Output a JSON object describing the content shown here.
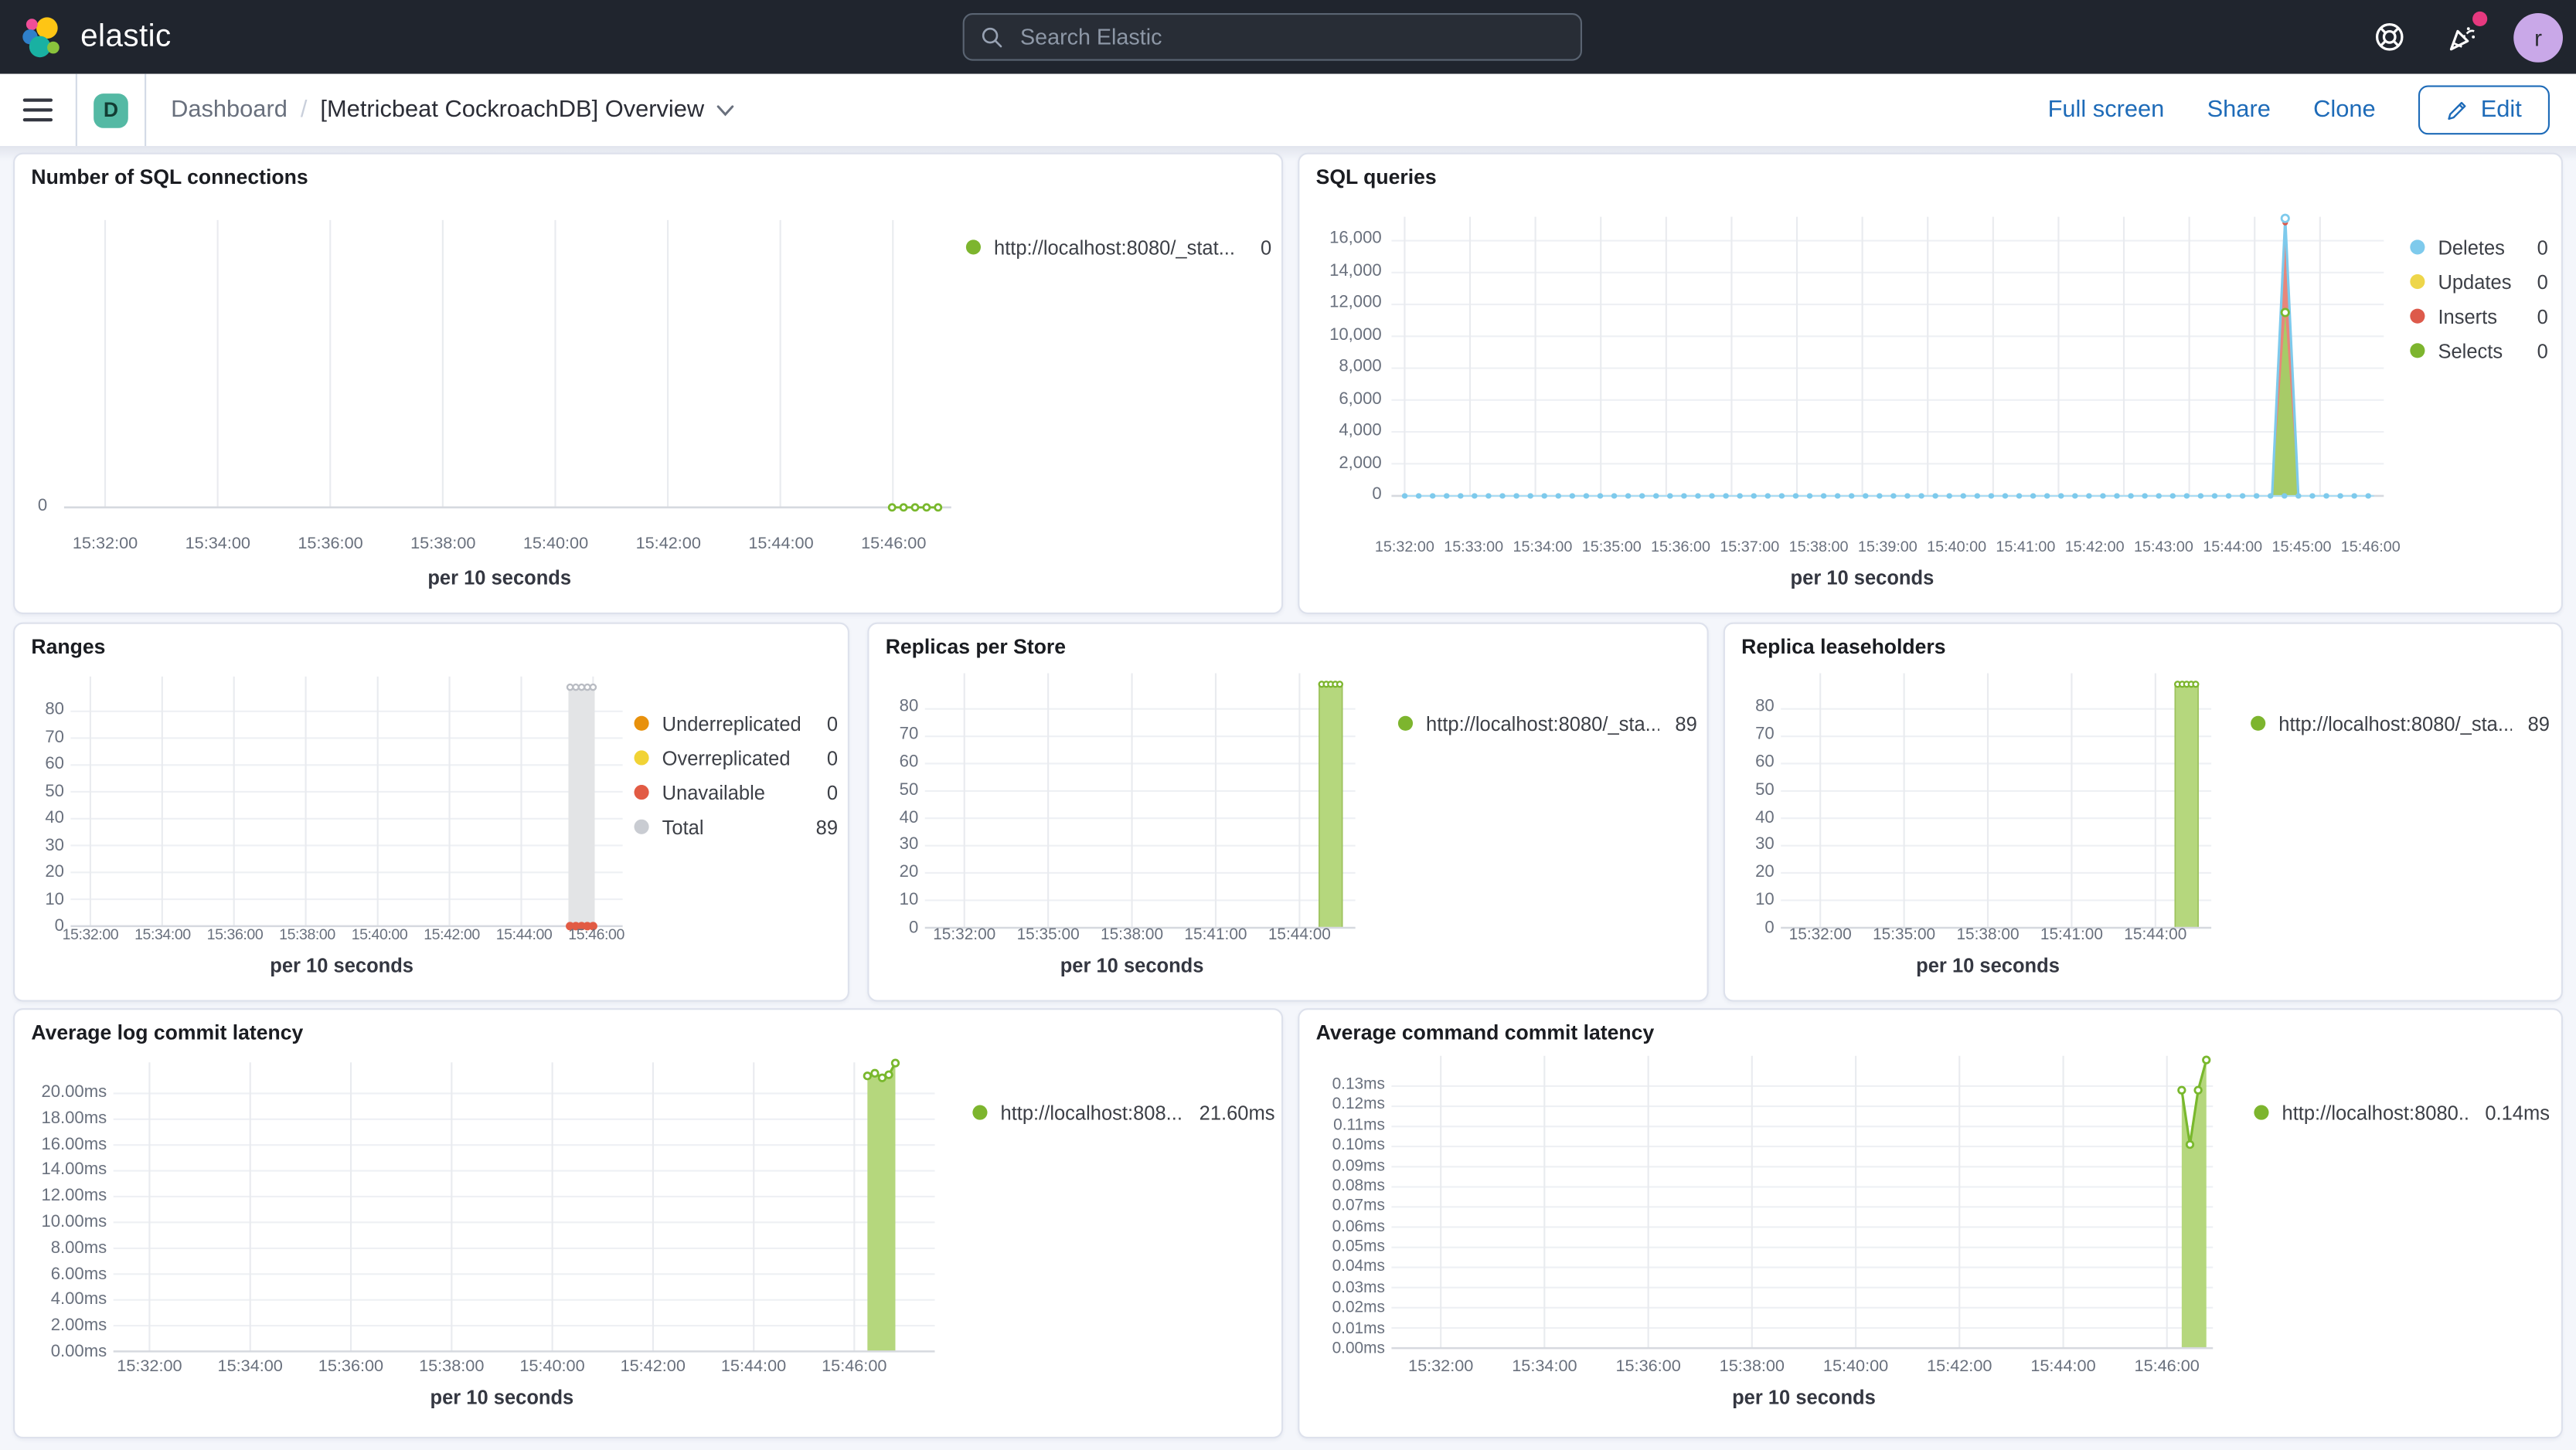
{
  "colors": {
    "header_bg": "#20252e",
    "link_blue": "#1e6bb8",
    "badge_teal": "#54b9a4",
    "avatar_purple": "#c9a8e8",
    "notification_pink": "#e6397f",
    "series_green": "#7db52e",
    "series_green_fill": "#b5d77d",
    "series_blue": "#7ecaec",
    "series_yellow": "#eed64a",
    "series_red": "#dd5a4b",
    "series_orange": "#e8910c",
    "series_gray": "#c9ccd2"
  },
  "header": {
    "logo_text": "elastic",
    "search_placeholder": "Search Elastic",
    "avatar_initial": "r"
  },
  "toolbar": {
    "breadcrumb_root": "Dashboard",
    "breadcrumb_sep": "/",
    "title": "[Metricbeat CockroachDB] Overview",
    "full_screen": "Full screen",
    "share": "Share",
    "clone": "Clone",
    "edit": "Edit"
  },
  "chart_data": [
    {
      "type": "line",
      "title": "Number of SQL connections",
      "xlabel": "per 10 seconds",
      "x_ticks": [
        "15:32:00",
        "15:34:00",
        "15:36:00",
        "15:38:00",
        "15:40:00",
        "15:42:00",
        "15:44:00",
        "15:46:00"
      ],
      "y_ticks": [
        "0"
      ],
      "ylim": [
        0,
        1
      ],
      "legend": [
        {
          "label": "http://localhost:8080/_stat...",
          "value": "0",
          "color": "#7db52e"
        }
      ],
      "series": [
        {
          "name": "http://localhost:8080/_stat...",
          "x": [
            "15:45:20",
            "15:45:30",
            "15:45:40",
            "15:45:50",
            "15:46:00"
          ],
          "values": [
            0,
            0,
            0,
            0,
            0
          ]
        }
      ]
    },
    {
      "type": "line",
      "title": "SQL queries",
      "xlabel": "per 10 seconds",
      "x_ticks": [
        "15:32:00",
        "15:33:00",
        "15:34:00",
        "15:35:00",
        "15:36:00",
        "15:37:00",
        "15:38:00",
        "15:39:00",
        "15:40:00",
        "15:41:00",
        "15:42:00",
        "15:43:00",
        "15:44:00",
        "15:45:00",
        "15:46:00"
      ],
      "y_ticks": [
        "16,000",
        "14,000",
        "12,000",
        "10,000",
        "8,000",
        "6,000",
        "4,000",
        "2,000",
        "0"
      ],
      "ylim": [
        0,
        17500
      ],
      "spike_time": "15:45:50",
      "legend": [
        {
          "label": "Deletes",
          "value": "0",
          "color": "#7ecaec"
        },
        {
          "label": "Updates",
          "value": "0",
          "color": "#eed64a"
        },
        {
          "label": "Inserts",
          "value": "0",
          "color": "#dd5a4b"
        },
        {
          "label": "Selects",
          "value": "0",
          "color": "#7db52e"
        }
      ],
      "series": [
        {
          "name": "Deletes",
          "baseline": 0,
          "peak": 17500
        },
        {
          "name": "Updates",
          "baseline": 0,
          "peak": 0
        },
        {
          "name": "Inserts",
          "baseline": 0,
          "peak": 17300
        },
        {
          "name": "Selects",
          "baseline": 0,
          "peak": 11500
        }
      ]
    },
    {
      "type": "bar",
      "title": "Ranges",
      "xlabel": "per 10 seconds",
      "x_ticks": [
        "15:32:00",
        "15:34:00",
        "15:36:00",
        "15:38:00",
        "15:40:00",
        "15:42:00",
        "15:44:00",
        "15:46:00"
      ],
      "y_ticks": [
        "80",
        "70",
        "60",
        "50",
        "40",
        "30",
        "20",
        "10",
        "0"
      ],
      "ylim": [
        0,
        93
      ],
      "bar_time": "15:45:50",
      "legend": [
        {
          "label": "Underreplicated",
          "value": "0",
          "color": "#e8910c"
        },
        {
          "label": "Overreplicated",
          "value": "0",
          "color": "#f1d335"
        },
        {
          "label": "Unavailable",
          "value": "0",
          "color": "#e25b44"
        },
        {
          "label": "Total",
          "value": "89",
          "color": "#c9ccd2"
        }
      ],
      "series": [
        {
          "name": "Underreplicated",
          "values": [
            0,
            0,
            0,
            0,
            0
          ]
        },
        {
          "name": "Overreplicated",
          "values": [
            0,
            0,
            0,
            0,
            0
          ]
        },
        {
          "name": "Unavailable",
          "values": [
            0,
            0,
            0,
            0,
            0
          ]
        },
        {
          "name": "Total",
          "values": [
            89,
            89,
            89,
            89,
            89
          ]
        }
      ]
    },
    {
      "type": "bar",
      "title": "Replicas per Store",
      "xlabel": "per 10 seconds",
      "x_ticks": [
        "15:32:00",
        "15:35:00",
        "15:38:00",
        "15:41:00",
        "15:44:00"
      ],
      "y_ticks": [
        "80",
        "70",
        "60",
        "50",
        "40",
        "30",
        "20",
        "10",
        "0"
      ],
      "ylim": [
        0,
        93
      ],
      "bar_time": "15:45:50",
      "legend": [
        {
          "label": "http://localhost:8080/_sta...",
          "value": "89",
          "color": "#7db52e"
        }
      ],
      "series": [
        {
          "name": "http://localhost:8080/_sta...",
          "values": [
            89,
            89,
            89,
            89,
            89
          ]
        }
      ]
    },
    {
      "type": "bar",
      "title": "Replica leaseholders",
      "xlabel": "per 10 seconds",
      "x_ticks": [
        "15:32:00",
        "15:35:00",
        "15:38:00",
        "15:41:00",
        "15:44:00"
      ],
      "y_ticks": [
        "80",
        "70",
        "60",
        "50",
        "40",
        "30",
        "20",
        "10",
        "0"
      ],
      "ylim": [
        0,
        93
      ],
      "bar_time": "15:45:50",
      "legend": [
        {
          "label": "http://localhost:8080/_sta...",
          "value": "89",
          "color": "#7db52e"
        }
      ],
      "series": [
        {
          "name": "http://localhost:8080/_sta...",
          "values": [
            89,
            89,
            89,
            89,
            89
          ]
        }
      ]
    },
    {
      "type": "area",
      "title": "Average log commit latency",
      "xlabel": "per 10 seconds",
      "x_ticks": [
        "15:32:00",
        "15:34:00",
        "15:36:00",
        "15:38:00",
        "15:40:00",
        "15:42:00",
        "15:44:00",
        "15:46:00"
      ],
      "y_ticks": [
        "20.00ms",
        "18.00ms",
        "16.00ms",
        "14.00ms",
        "12.00ms",
        "10.00ms",
        "8.00ms",
        "6.00ms",
        "4.00ms",
        "2.00ms",
        "0.00ms"
      ],
      "ylim": [
        0,
        22.4
      ],
      "legend": [
        {
          "label": "http://localhost:808...",
          "value": "21.60ms",
          "color": "#7db52e"
        }
      ],
      "series": [
        {
          "name": "http://localhost:808...",
          "x": [
            "15:45:20",
            "15:45:30",
            "15:45:40",
            "15:45:50",
            "15:46:00"
          ],
          "values": [
            21.35,
            21.55,
            21.2,
            21.45,
            22.35
          ]
        }
      ]
    },
    {
      "type": "area",
      "title": "Average command commit latency",
      "xlabel": "per 10 seconds",
      "x_ticks": [
        "15:32:00",
        "15:34:00",
        "15:36:00",
        "15:38:00",
        "15:40:00",
        "15:42:00",
        "15:44:00",
        "15:46:00"
      ],
      "y_ticks": [
        "0.13ms",
        "0.12ms",
        "0.11ms",
        "0.10ms",
        "0.09ms",
        "0.08ms",
        "0.07ms",
        "0.06ms",
        "0.05ms",
        "0.04ms",
        "0.03ms",
        "0.02ms",
        "0.01ms",
        "0.00ms"
      ],
      "ylim": [
        0,
        0.145
      ],
      "legend": [
        {
          "label": "http://localhost:8080...",
          "value": "0.14ms",
          "color": "#7db52e"
        }
      ],
      "series": [
        {
          "name": "http://localhost:8080...",
          "x": [
            "15:45:30",
            "15:45:40",
            "15:45:50",
            "15:46:00"
          ],
          "values": [
            0.128,
            0.101,
            0.128,
            0.143
          ]
        }
      ]
    }
  ]
}
